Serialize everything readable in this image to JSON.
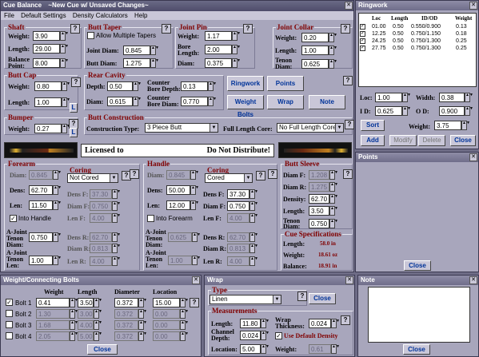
{
  "main": {
    "title": "Cue Balance",
    "subtitle": "~New Cue w/ Unsaved Changes~",
    "menu": [
      "File",
      "Default Settings",
      "Density Calculators",
      "Help"
    ],
    "shaft": {
      "title": "Shaft",
      "weight_label": "Weight:",
      "weight": "3.90",
      "length_label": "Length:",
      "length": "29.00",
      "bp_label1": "Balance",
      "bp_label2": "Point:",
      "bp": "8.00"
    },
    "butt_taper": {
      "title": "Butt Taper",
      "allow_multiple": "Allow Multiple Tapers",
      "joint_label": "Joint Diam:",
      "joint": "0.845",
      "butt_label": "Butt Diam:",
      "butt": "1.275"
    },
    "joint_pin": {
      "title": "Joint Pin",
      "weight_label": "Weight:",
      "weight": "1.17",
      "bore_label1": "Bore",
      "bore_label2": "Length:",
      "bore": "2.00",
      "diam_label": "Diam:",
      "diam": "0.375"
    },
    "joint_collar": {
      "title": "Joint Collar",
      "weight_label": "Weight:",
      "weight": "0.20",
      "length_label": "Length:",
      "length": "1.00",
      "tenon_label1": "Tenon",
      "tenon_label2": "Diam:",
      "tenon": "0.625"
    },
    "butt_cap": {
      "title": "Butt Cap",
      "weight_label": "Weight:",
      "weight": "0.80",
      "length_label": "Length:",
      "length": "1.00"
    },
    "rear_cavity": {
      "title": "Rear Cavity",
      "depth_label": "Depth:",
      "depth": "0.50",
      "diam_label": "Diam:",
      "diam": "0.615",
      "cb_depth_label1": "Counter",
      "cb_depth_label2": "Bore Depth:",
      "cb_depth": "0.13",
      "cb_diam_label1": "Counter",
      "cb_diam_label2": "Bore Diam:",
      "cb_diam": "0.770"
    },
    "buttons": {
      "ringwork": "Ringwork",
      "points": "Points",
      "weight_bolts": "Weight Bolts",
      "wrap": "Wrap",
      "note": "Note",
      "l": "L"
    },
    "bumper": {
      "title": "Bumper",
      "weight_label": "Weight:",
      "weight": "0.27"
    },
    "butt_construction": {
      "title": "Butt Construction",
      "type_label": "Construction Type:",
      "type": "3 Piece Butt",
      "flc_label": "Full Length Core:",
      "flc": "No Full Length Core"
    },
    "banner": {
      "left": "Licensed to",
      "right": "Do Not Distribute!"
    },
    "forearm": {
      "title": "Forearm",
      "diam_label": "Diam:",
      "diam": "0.845",
      "dens_label": "Dens:",
      "dens": "62.70",
      "len_label": "Len:",
      "len": "11.50",
      "into_handle": "Into Handle",
      "ajt_label1": "A-Joint",
      "ajt_label2": "Tenon",
      "ajt_label3": "Diam:",
      "ajt": "0.750",
      "ajl_label1": "A-Joint",
      "ajl_label2": "Tenon",
      "ajl_label3": "Len:",
      "ajl": "1.00",
      "coring_title": "Coring",
      "coring": "Not Cored",
      "densf_label": "Dens F:",
      "densf": "37.30",
      "diamf_label": "Diam F:",
      "diamf": "0.750",
      "lenf_label": "Len F:",
      "lenf": "4.00",
      "densr_label": "Dens R:",
      "densr": "62.70",
      "diamr_label": "Diam R:",
      "diamr": "0.813",
      "lenr_label": "Len R:",
      "lenr": "4.00"
    },
    "handle": {
      "title": "Handle",
      "diam_label": "Diam:",
      "diam": "0.845",
      "dens_label": "Dens:",
      "dens": "50.00",
      "len_label": "Len:",
      "len": "12.00",
      "into_forearm": "Into Forearm",
      "ajt_label1": "A-Joint",
      "ajt_label2": "Tenon",
      "ajt_label3": "Diam:",
      "ajt": "0.625",
      "ajl_label1": "A-Joint",
      "ajl_label2": "Tenon",
      "ajl_label3": "Len:",
      "ajl": "1.00",
      "coring_title": "Coring",
      "coring": "Cored",
      "densf_label": "Dens F:",
      "densf": "37.30",
      "diamf_label": "Diam F:",
      "diamf": "0.750",
      "lenf_label": "Len F:",
      "lenf": "4.00",
      "densr_label": "Dens R:",
      "densr": "62.70",
      "diamr_label": "Diam R:",
      "diamr": "0.813",
      "lenr_label": "Len R:",
      "lenr": "4.00"
    },
    "butt_sleeve": {
      "title": "Butt Sleeve",
      "diamf_label": "Diam F:",
      "diamf": "1.208",
      "diamr_label": "Diam R:",
      "diamr": "1.275",
      "density_label": "Density:",
      "density": "62.70",
      "length_label": "Length:",
      "length": "3.50",
      "tenon_label1": "Tenon",
      "tenon_label2": "Diam:",
      "tenon": "0.750"
    },
    "cue_spec": {
      "title": "Cue Specifications",
      "length_label": "Length:",
      "length": "58.0 in",
      "weight_label": "Weight:",
      "weight": "18.61 oz",
      "balance_label": "Balance:",
      "balance": "18.91 in"
    }
  },
  "ringwork": {
    "title": "Ringwork",
    "columns": [
      "Loc",
      "Length",
      "ID/OD",
      "Weight"
    ],
    "rows": [
      [
        "01.00",
        "0.50",
        "0.550/0.900",
        "0.13"
      ],
      [
        "12.25",
        "0.50",
        "0.750/1.150",
        "0.18"
      ],
      [
        "24.25",
        "0.50",
        "0.750/1.300",
        "0.25"
      ],
      [
        "27.75",
        "0.50",
        "0.750/1.300",
        "0.25"
      ]
    ],
    "loc_label": "Loc:",
    "loc": "1.00",
    "width_label": "Width:",
    "width": "0.38",
    "id_label": "I D:",
    "id": "0.625",
    "od_label": "O D:",
    "od": "0.900",
    "sort": "Sort",
    "weight_label": "Weight:",
    "weight": "3.75",
    "add": "Add",
    "modify": "Modify",
    "delete": "Delete",
    "close": "Close"
  },
  "points": {
    "title": "Points",
    "close": "Close"
  },
  "weight_bolts": {
    "title": "Weight/Connecting Bolts",
    "columns": [
      "Weight",
      "Length",
      "Diameter",
      "Location"
    ],
    "rows": [
      {
        "name": "Bolt 1",
        "checked": "✓",
        "weight": "0.41",
        "length": "3.50",
        "diameter": "0.372",
        "location": "15.00"
      },
      {
        "name": "Bolt 2",
        "checked": "",
        "weight": "1.30",
        "length": "3.00",
        "diameter": "0.372",
        "location": "0.00"
      },
      {
        "name": "Bolt 3",
        "checked": "",
        "weight": "1.68",
        "length": "4.00",
        "diameter": "0.372",
        "location": "0.00"
      },
      {
        "name": "Bolt 4",
        "checked": "",
        "weight": "2.05",
        "length": "5.00",
        "diameter": "0.372",
        "location": "0.00"
      }
    ],
    "close": "Close"
  },
  "wrap": {
    "title": "Wrap",
    "type_title": "Type",
    "type": "Linen",
    "close": "Close",
    "measurements_title": "Measurements",
    "length_label": "Length:",
    "length": "11.80",
    "wt_label1": "Wrap",
    "wt_label2": "Thickness:",
    "wt": "0.024",
    "cd_label1": "Channel",
    "cd_label2": "Depth:",
    "cd": "0.024",
    "use_default": "Use Default Density",
    "location_label": "Location:",
    "location": "5.00",
    "weight_label": "Weight:",
    "weight": "0.61"
  },
  "note": {
    "title": "Note",
    "close": "Close"
  }
}
